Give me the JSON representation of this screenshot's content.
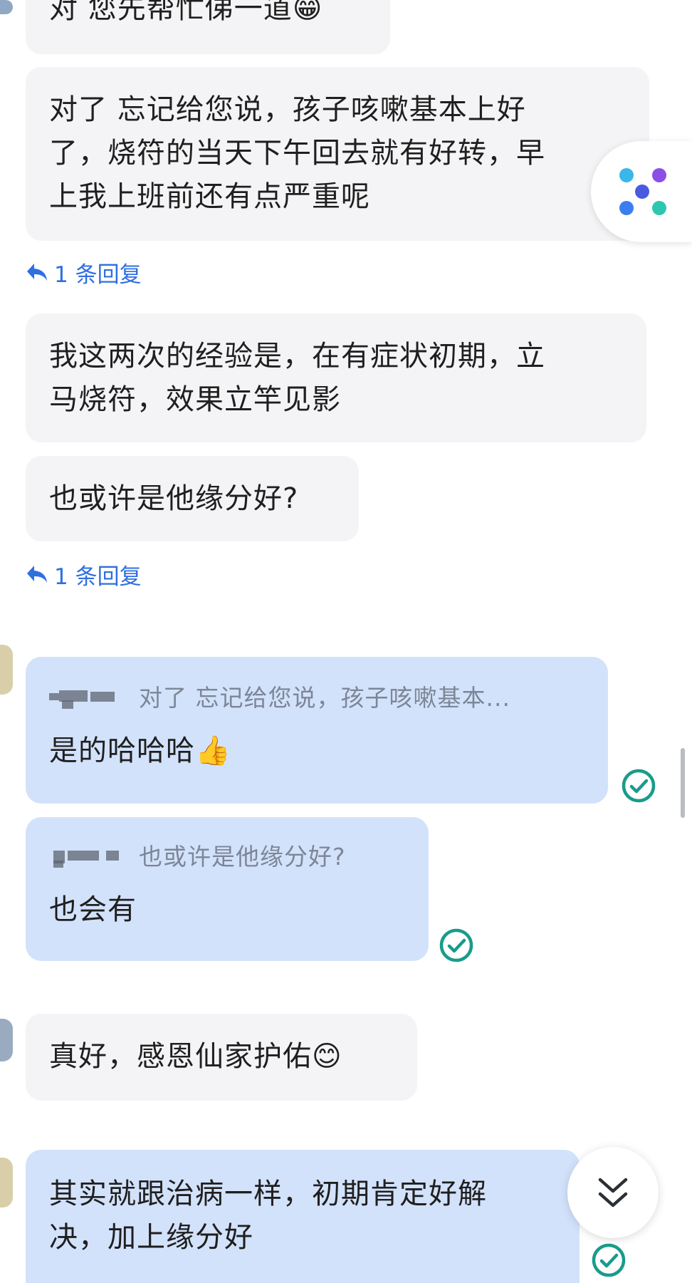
{
  "colors": {
    "incoming_bubble": "#f4f4f6",
    "outgoing_bubble": "#d3e2fb",
    "reply_link": "#2f6fe0",
    "read_check": "#1a9b8a"
  },
  "messages": [
    {
      "id": "m1",
      "dir": "in",
      "text": "对 您先帮忙俤一道😁"
    },
    {
      "id": "m2",
      "dir": "in",
      "lines": [
        "对了 忘记给您说，孩子咳嗽基本上好",
        "了，烧符的当天下午回去就有好转，早",
        "上我上班前还有点严重呢"
      ]
    },
    {
      "id": "m3",
      "dir": "in",
      "lines": [
        "我这两次的经验是，在有症状初期，立",
        "马烧符，效果立竿见影"
      ]
    },
    {
      "id": "m4",
      "dir": "in",
      "text": "也或许是他缘分好?"
    },
    {
      "id": "m5",
      "dir": "out",
      "quote": "对了 忘记给您说，孩子咳嗽基本...",
      "text": "是的哈哈哈👍"
    },
    {
      "id": "m6",
      "dir": "out",
      "quote": "也或许是他缘分好?",
      "text": "也会有"
    },
    {
      "id": "m7",
      "dir": "in",
      "text": "真好，感恩仙家护佑😊"
    },
    {
      "id": "m8",
      "dir": "out",
      "lines": [
        "其实就跟治病一样，初期肯定好解",
        "决，加上缘分好"
      ]
    }
  ],
  "reply_links": [
    "1 条回复",
    "1 条回复"
  ],
  "icons": {
    "reply": "reply-arrow-icon",
    "read": "read-check-icon",
    "app": "dots-app-icon",
    "scroll": "double-chevron-down-icon"
  }
}
